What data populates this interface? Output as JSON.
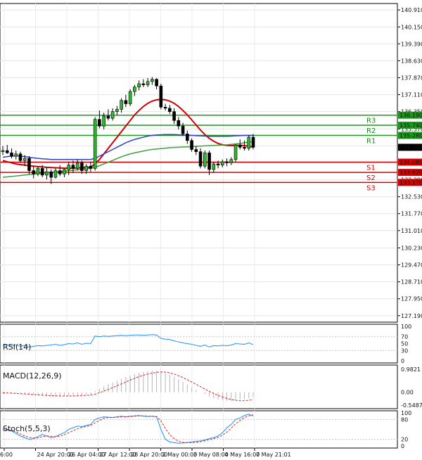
{
  "chart_data": {
    "type": "candlestick",
    "price_axis": {
      "ylim": [
        126.9,
        141.2
      ],
      "ticks": [
        "140.910",
        "140.150",
        "139.390",
        "138.630",
        "137.870",
        "137.110",
        "136.350",
        "135.570",
        "134.810",
        "134.050",
        "133.290",
        "132.530",
        "131.770",
        "131.010",
        "130.230",
        "129.470",
        "128.710",
        "127.950",
        "127.190"
      ]
    },
    "time_axis": {
      "labels": [
        "6:00",
        "24 Apr 20:00",
        "26 Apr 04:00",
        "27 Apr 12:00",
        "28 Apr 20:00",
        "2 May 00:00",
        "3 May 08:00",
        "4 May 16:00",
        "7 May 21:01"
      ]
    },
    "levels": {
      "resistance": [
        {
          "name": "R3",
          "value": 136.19,
          "label": "136.190"
        },
        {
          "name": "R2",
          "value": 135.74,
          "label": "135.740"
        },
        {
          "name": "R1",
          "value": 135.28,
          "label": "135.280"
        }
      ],
      "support": [
        {
          "name": "S1",
          "value": 134.08,
          "label": "134.080"
        },
        {
          "name": "S2",
          "value": 133.62,
          "label": "133.620"
        },
        {
          "name": "S3",
          "value": 133.17,
          "label": "133.170"
        }
      ]
    },
    "current_price": {
      "value": 134.747,
      "label": "134.747"
    },
    "candles": [
      {
        "o": 134.55,
        "h": 134.8,
        "l": 134.4,
        "c": 134.6
      },
      {
        "o": 134.6,
        "h": 134.85,
        "l": 134.45,
        "c": 134.5
      },
      {
        "o": 134.5,
        "h": 134.7,
        "l": 134.25,
        "c": 134.35
      },
      {
        "o": 134.35,
        "h": 134.6,
        "l": 134.2,
        "c": 134.45
      },
      {
        "o": 134.45,
        "h": 134.55,
        "l": 134.05,
        "c": 134.15
      },
      {
        "o": 134.15,
        "h": 134.4,
        "l": 133.9,
        "c": 134.25
      },
      {
        "o": 134.25,
        "h": 134.35,
        "l": 133.55,
        "c": 133.7
      },
      {
        "o": 133.7,
        "h": 133.9,
        "l": 133.35,
        "c": 133.55
      },
      {
        "o": 133.55,
        "h": 133.9,
        "l": 133.45,
        "c": 133.8
      },
      {
        "o": 133.8,
        "h": 133.95,
        "l": 133.4,
        "c": 133.5
      },
      {
        "o": 133.5,
        "h": 133.85,
        "l": 133.3,
        "c": 133.65
      },
      {
        "o": 133.65,
        "h": 133.75,
        "l": 133.1,
        "c": 133.4
      },
      {
        "o": 133.4,
        "h": 133.8,
        "l": 133.35,
        "c": 133.7
      },
      {
        "o": 133.7,
        "h": 133.95,
        "l": 133.45,
        "c": 133.55
      },
      {
        "o": 133.55,
        "h": 133.8,
        "l": 133.4,
        "c": 133.75
      },
      {
        "o": 133.75,
        "h": 134.1,
        "l": 133.5,
        "c": 133.95
      },
      {
        "o": 133.95,
        "h": 134.15,
        "l": 133.6,
        "c": 133.8
      },
      {
        "o": 133.8,
        "h": 134.2,
        "l": 133.7,
        "c": 134.05
      },
      {
        "o": 134.05,
        "h": 134.15,
        "l": 133.55,
        "c": 133.7
      },
      {
        "o": 133.7,
        "h": 134.0,
        "l": 133.55,
        "c": 133.9
      },
      {
        "o": 133.9,
        "h": 134.1,
        "l": 133.65,
        "c": 133.8
      },
      {
        "o": 133.8,
        "h": 136.1,
        "l": 133.7,
        "c": 136.0
      },
      {
        "o": 136.0,
        "h": 136.4,
        "l": 135.6,
        "c": 135.7
      },
      {
        "o": 135.7,
        "h": 136.3,
        "l": 135.55,
        "c": 136.15
      },
      {
        "o": 136.15,
        "h": 136.45,
        "l": 135.95,
        "c": 136.05
      },
      {
        "o": 136.05,
        "h": 136.5,
        "l": 135.95,
        "c": 136.35
      },
      {
        "o": 136.35,
        "h": 136.6,
        "l": 136.2,
        "c": 136.45
      },
      {
        "o": 136.45,
        "h": 136.95,
        "l": 136.3,
        "c": 136.85
      },
      {
        "o": 136.85,
        "h": 137.1,
        "l": 136.55,
        "c": 136.7
      },
      {
        "o": 136.7,
        "h": 137.35,
        "l": 136.6,
        "c": 137.25
      },
      {
        "o": 137.25,
        "h": 137.55,
        "l": 137.05,
        "c": 137.45
      },
      {
        "o": 137.45,
        "h": 137.75,
        "l": 137.3,
        "c": 137.6
      },
      {
        "o": 137.6,
        "h": 137.8,
        "l": 137.45,
        "c": 137.55
      },
      {
        "o": 137.55,
        "h": 137.85,
        "l": 137.45,
        "c": 137.7
      },
      {
        "o": 137.7,
        "h": 137.9,
        "l": 137.55,
        "c": 137.8
      },
      {
        "o": 137.8,
        "h": 137.85,
        "l": 137.35,
        "c": 137.5
      },
      {
        "o": 137.5,
        "h": 137.6,
        "l": 136.45,
        "c": 136.55
      },
      {
        "o": 136.55,
        "h": 136.7,
        "l": 136.4,
        "c": 136.5
      },
      {
        "o": 136.5,
        "h": 136.65,
        "l": 136.25,
        "c": 136.35
      },
      {
        "o": 136.35,
        "h": 136.5,
        "l": 135.8,
        "c": 135.95
      },
      {
        "o": 135.95,
        "h": 136.1,
        "l": 135.55,
        "c": 135.7
      },
      {
        "o": 135.7,
        "h": 135.85,
        "l": 135.25,
        "c": 135.35
      },
      {
        "o": 135.35,
        "h": 135.5,
        "l": 134.9,
        "c": 135.05
      },
      {
        "o": 135.05,
        "h": 135.15,
        "l": 134.55,
        "c": 134.65
      },
      {
        "o": 134.65,
        "h": 134.8,
        "l": 134.4,
        "c": 134.55
      },
      {
        "o": 134.55,
        "h": 134.7,
        "l": 133.8,
        "c": 133.9
      },
      {
        "o": 133.9,
        "h": 134.6,
        "l": 133.8,
        "c": 134.5
      },
      {
        "o": 134.5,
        "h": 134.6,
        "l": 133.5,
        "c": 133.75
      },
      {
        "o": 133.75,
        "h": 134.1,
        "l": 133.6,
        "c": 134.0
      },
      {
        "o": 134.0,
        "h": 134.15,
        "l": 133.8,
        "c": 133.95
      },
      {
        "o": 133.95,
        "h": 134.2,
        "l": 133.85,
        "c": 134.1
      },
      {
        "o": 134.1,
        "h": 134.25,
        "l": 133.9,
        "c": 134.05
      },
      {
        "o": 134.05,
        "h": 134.3,
        "l": 133.95,
        "c": 134.2
      },
      {
        "o": 134.2,
        "h": 134.9,
        "l": 134.1,
        "c": 134.85
      },
      {
        "o": 134.85,
        "h": 135.1,
        "l": 134.65,
        "c": 134.75
      },
      {
        "o": 134.75,
        "h": 135.05,
        "l": 134.6,
        "c": 134.7
      },
      {
        "o": 134.7,
        "h": 135.3,
        "l": 134.6,
        "c": 135.2
      },
      {
        "o": 135.2,
        "h": 135.35,
        "l": 134.65,
        "c": 134.75
      }
    ],
    "overlays": [
      {
        "color": "#d00000",
        "values": [
          134.15,
          134.1,
          134.05,
          134.0,
          133.97,
          133.95,
          133.92,
          133.9,
          133.88,
          133.87,
          133.85,
          133.84,
          133.83,
          133.82,
          133.81,
          133.81,
          133.81,
          133.82,
          133.83,
          133.84,
          133.86,
          134.0,
          134.2,
          134.45,
          134.7,
          134.95,
          135.2,
          135.45,
          135.7,
          135.95,
          136.2,
          136.4,
          136.58,
          136.72,
          136.82,
          136.88,
          136.9,
          136.88,
          136.82,
          136.72,
          136.58,
          136.4,
          136.2,
          135.98,
          135.75,
          135.52,
          135.32,
          135.15,
          135.02,
          134.92,
          134.86,
          134.83,
          134.82,
          134.83,
          134.84,
          134.82,
          134.8,
          134.75
        ]
      },
      {
        "color": "#3040d0",
        "values": [
          134.3,
          134.33,
          134.35,
          134.36,
          134.35,
          134.33,
          134.3,
          134.27,
          134.25,
          134.23,
          134.22,
          134.2,
          134.2,
          134.2,
          134.2,
          134.2,
          134.2,
          134.2,
          134.2,
          134.2,
          134.2,
          134.25,
          134.35,
          134.45,
          134.55,
          134.65,
          134.75,
          134.85,
          134.95,
          135.03,
          135.1,
          135.15,
          135.2,
          135.25,
          135.28,
          135.3,
          135.31,
          135.32,
          135.32,
          135.32,
          135.31,
          135.3,
          135.29,
          135.28,
          135.27,
          135.26,
          135.25,
          135.24,
          135.24,
          135.24,
          135.24,
          135.24,
          135.25,
          135.26,
          135.27,
          135.28,
          135.28,
          135.28
        ]
      },
      {
        "color": "#3ca03c",
        "values": [
          133.4,
          133.42,
          133.44,
          133.46,
          133.48,
          133.5,
          133.52,
          133.54,
          133.56,
          133.58,
          133.6,
          133.62,
          133.64,
          133.66,
          133.68,
          133.7,
          133.72,
          133.74,
          133.76,
          133.78,
          133.8,
          133.85,
          133.92,
          134.0,
          134.08,
          134.16,
          134.24,
          134.32,
          134.39,
          134.45,
          134.5,
          134.54,
          134.58,
          134.62,
          134.65,
          134.67,
          134.69,
          134.71,
          134.73,
          134.74,
          134.75,
          134.76,
          134.77,
          134.78,
          134.79,
          134.8,
          134.81,
          134.82,
          134.83,
          134.84,
          134.85,
          134.86,
          134.88,
          134.9,
          134.92,
          134.95,
          134.98,
          135.0
        ]
      }
    ],
    "indicators": [
      {
        "name": "RSI(14)",
        "ticks": [
          "100",
          "70",
          "50",
          "30",
          "0"
        ],
        "ylim": [
          0,
          100
        ],
        "series_color": "#1e90ff",
        "values": [
          46,
          47,
          44,
          46,
          42,
          45,
          40,
          42,
          44,
          43,
          45,
          46,
          48,
          45,
          47,
          50,
          49,
          52,
          48,
          51,
          50,
          72,
          70,
          72,
          71,
          72,
          73,
          74,
          73,
          74,
          75,
          75,
          74,
          75,
          76,
          75,
          65,
          63,
          62,
          58,
          55,
          52,
          50,
          48,
          45,
          42,
          46,
          40,
          44,
          43,
          45,
          44,
          46,
          50,
          49,
          48,
          52,
          47
        ]
      },
      {
        "name": "MACD(12,26,9)",
        "ticks": [
          "0.9821",
          "0.00",
          "-0.5487"
        ],
        "ylim": [
          -0.5487,
          0.9821
        ],
        "hist_color": "#b5b5b5",
        "signal_color": "#e02020",
        "histogram": [
          -0.05,
          -0.05,
          -0.06,
          -0.06,
          -0.07,
          -0.08,
          -0.1,
          -0.12,
          -0.13,
          -0.15,
          -0.16,
          -0.18,
          -0.18,
          -0.19,
          -0.18,
          -0.17,
          -0.15,
          -0.13,
          -0.12,
          -0.11,
          -0.1,
          0.05,
          0.15,
          0.25,
          0.35,
          0.42,
          0.5,
          0.58,
          0.65,
          0.72,
          0.78,
          0.83,
          0.87,
          0.9,
          0.92,
          0.93,
          0.88,
          0.82,
          0.75,
          0.66,
          0.56,
          0.45,
          0.34,
          0.22,
          0.1,
          0.0,
          -0.08,
          -0.18,
          -0.25,
          -0.3,
          -0.34,
          -0.36,
          -0.37,
          -0.35,
          -0.32,
          -0.3,
          -0.25,
          -0.2
        ],
        "signal": [
          -0.02,
          -0.03,
          -0.04,
          -0.05,
          -0.06,
          -0.07,
          -0.08,
          -0.1,
          -0.11,
          -0.12,
          -0.13,
          -0.14,
          -0.15,
          -0.16,
          -0.16,
          -0.16,
          -0.16,
          -0.15,
          -0.14,
          -0.13,
          -0.12,
          -0.08,
          -0.02,
          0.05,
          0.12,
          0.2,
          0.28,
          0.36,
          0.44,
          0.52,
          0.6,
          0.67,
          0.73,
          0.78,
          0.82,
          0.85,
          0.87,
          0.86,
          0.83,
          0.78,
          0.71,
          0.63,
          0.54,
          0.44,
          0.34,
          0.24,
          0.14,
          0.04,
          -0.05,
          -0.13,
          -0.2,
          -0.26,
          -0.31,
          -0.34,
          -0.36,
          -0.36,
          -0.34,
          -0.31
        ]
      },
      {
        "name": "Stoch(5,5,3)",
        "ticks": [
          "100",
          "80",
          "20",
          "0"
        ],
        "ylim": [
          0,
          100
        ],
        "main_color": "#1e90ff",
        "signal_color": "#e02020",
        "main": [
          50,
          48,
          45,
          38,
          30,
          25,
          20,
          22,
          28,
          35,
          30,
          25,
          28,
          35,
          40,
          50,
          55,
          60,
          58,
          62,
          65,
          80,
          85,
          88,
          87,
          86,
          88,
          90,
          88,
          90,
          91,
          92,
          90,
          89,
          90,
          88,
          50,
          20,
          12,
          10,
          8,
          9,
          10,
          12,
          14,
          15,
          18,
          22,
          25,
          30,
          40,
          55,
          65,
          80,
          85,
          92,
          96,
          90
        ],
        "signal": [
          52,
          50,
          47,
          42,
          36,
          30,
          26,
          24,
          25,
          28,
          30,
          29,
          28,
          30,
          34,
          40,
          46,
          52,
          56,
          59,
          62,
          70,
          77,
          84,
          86,
          86,
          87,
          88,
          88,
          89,
          90,
          91,
          91,
          90,
          90,
          89,
          76,
          53,
          34,
          22,
          14,
          11,
          10,
          10,
          11,
          13,
          16,
          19,
          22,
          26,
          32,
          42,
          54,
          67,
          77,
          86,
          91,
          94
        ]
      }
    ]
  }
}
